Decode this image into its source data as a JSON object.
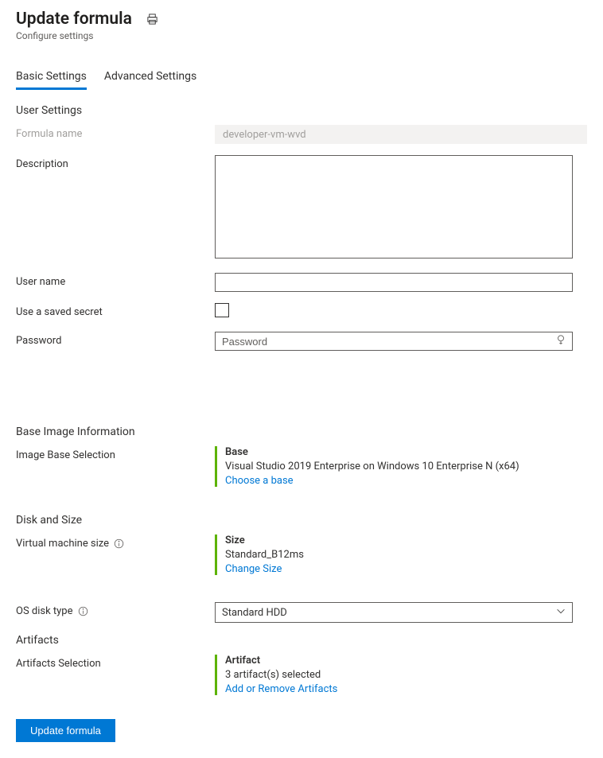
{
  "header": {
    "title": "Update formula",
    "subtitle": "Configure settings"
  },
  "tabs": {
    "basic": "Basic Settings",
    "advanced": "Advanced Settings"
  },
  "user_settings": {
    "section_title": "User Settings",
    "formula_name_label": "Formula name",
    "formula_name_value": "developer-vm-wvd",
    "description_label": "Description",
    "description_value": "",
    "username_label": "User name",
    "username_value": "",
    "saved_secret_label": "Use a saved secret",
    "password_label": "Password",
    "password_placeholder": "Password"
  },
  "base_image": {
    "section_title": "Base Image Information",
    "selection_label": "Image Base Selection",
    "info_title": "Base",
    "info_value": "Visual Studio 2019 Enterprise on Windows 10 Enterprise N (x64)",
    "info_link": "Choose a base"
  },
  "disk_size": {
    "section_title": "Disk and Size",
    "vm_size_label": "Virtual machine size",
    "size_title": "Size",
    "size_value": "Standard_B12ms",
    "size_link": "Change Size",
    "os_disk_label": "OS disk type",
    "os_disk_value": "Standard HDD"
  },
  "artifacts": {
    "section_title": "Artifacts",
    "selection_label": "Artifacts Selection",
    "info_title": "Artifact",
    "info_value": "3 artifact(s) selected",
    "info_link": "Add or Remove Artifacts"
  },
  "footer": {
    "update_btn": "Update formula"
  }
}
